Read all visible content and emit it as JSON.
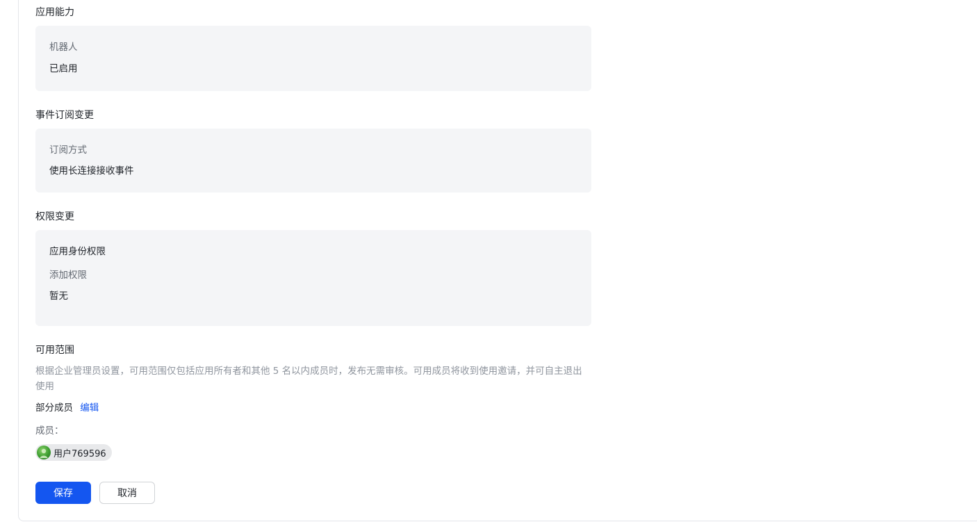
{
  "sections": {
    "app_ability": {
      "title": "应用能力",
      "label": "机器人",
      "value": "已启用"
    },
    "event_subscription": {
      "title": "事件订阅变更",
      "label": "订阅方式",
      "value": "使用长连接接收事件"
    },
    "permission": {
      "title": "权限变更",
      "sub_title": "应用身份权限",
      "label": "添加权限",
      "value": "暂无"
    },
    "availability": {
      "title": "可用范围",
      "description": "根据企业管理员设置，可用范围仅包括应用所有者和其他 5 名以内成员时，发布无需审核。可用成员将收到使用邀请，并可自主退出使用",
      "scope_value": "部分成员",
      "edit_link": "编辑",
      "members_label": "成员：",
      "members": [
        {
          "name": "用户769596",
          "avatar_icon": "user-avatar-icon"
        }
      ]
    }
  },
  "actions": {
    "save_label": "保存",
    "cancel_label": "取消"
  },
  "colors": {
    "primary": "#1456f0",
    "box_bg": "#f4f5f7",
    "muted_text": "#8f959e"
  }
}
